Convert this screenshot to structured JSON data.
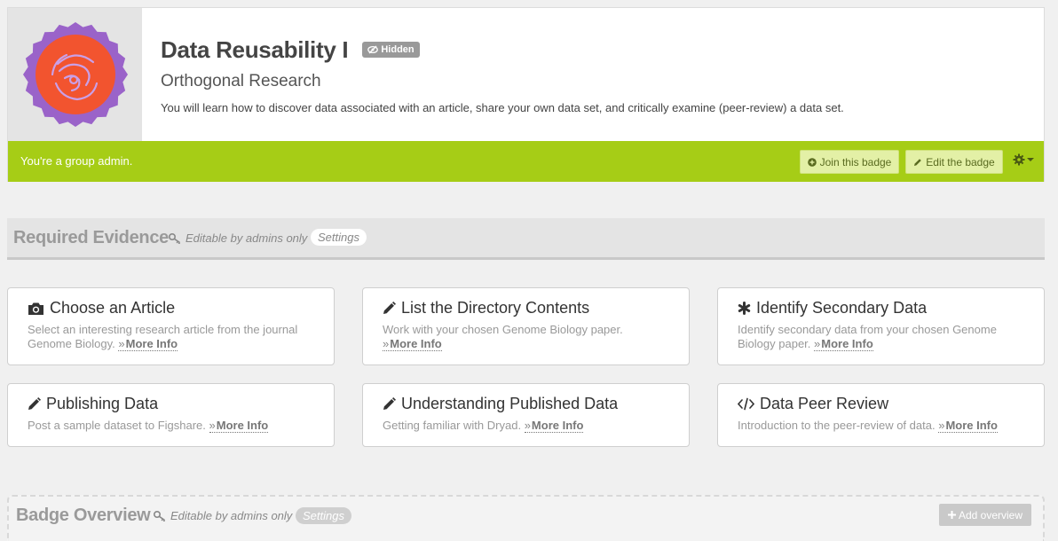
{
  "badge": {
    "title": "Data Reusability I",
    "visibility_tag": "Hidden",
    "group": "Orthogonal Research",
    "description": "You will learn how to discover data associated with an article, share your own data set, and critically examine (peer-review) a data set.",
    "image_icon": "badge-seal-icon",
    "colors": {
      "seal_outer": "#9a63c9",
      "seal_inner": "#f2542f",
      "admin_bar": "#a6cd16"
    }
  },
  "admin_bar": {
    "status_text": "You're a group admin.",
    "join_label": "Join this badge",
    "edit_label": "Edit the badge",
    "gear_icon": "gear-icon"
  },
  "required_evidence": {
    "title": "Required Evidence",
    "note": "Editable by admins only",
    "settings_label": "Settings",
    "more_info_label": "More Info",
    "items": [
      {
        "icon": "camera-icon",
        "title": "Choose an Article",
        "description": "Select an interesting research article from the journal Genome Biology."
      },
      {
        "icon": "pencil-icon",
        "title": "List the Directory Contents",
        "description": "Work with your chosen Genome Biology paper."
      },
      {
        "icon": "asterisk-icon",
        "title": "Identify Secondary Data",
        "description": "Identify secondary data from your chosen Genome Biology paper."
      },
      {
        "icon": "pencil-icon",
        "title": "Publishing Data",
        "description": "Post a sample dataset to Figshare."
      },
      {
        "icon": "pencil-icon",
        "title": "Understanding Published Data",
        "description": "Getting familiar with Dryad."
      },
      {
        "icon": "code-icon",
        "title": "Data Peer Review",
        "description": "Introduction to the peer-review of data."
      }
    ]
  },
  "badge_overview": {
    "title": "Badge Overview",
    "note": "Editable by admins only",
    "settings_label": "Settings",
    "add_label": "Add overview"
  }
}
